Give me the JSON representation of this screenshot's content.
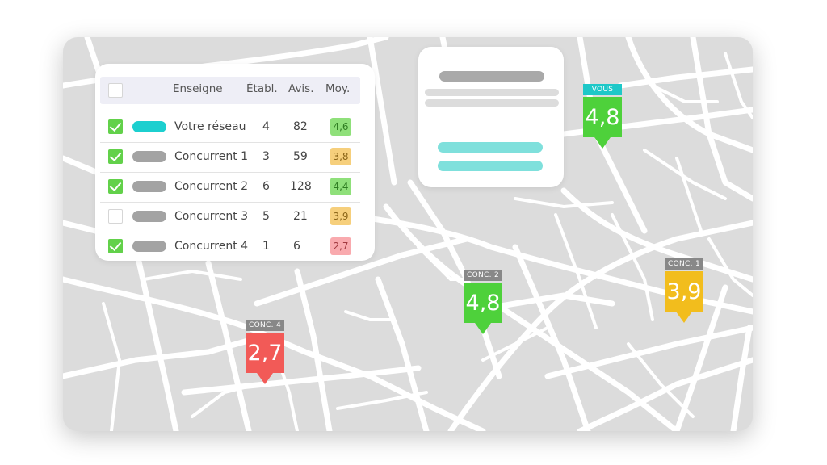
{
  "table": {
    "headers": {
      "brand": "Enseigne",
      "establishments": "Établ.",
      "reviews": "Avis.",
      "average": "Moy."
    },
    "rows": [
      {
        "checked": true,
        "pill_color": "#1ccfcf",
        "name": "Votre réseau",
        "establishments": "4",
        "reviews": "82",
        "average": "4,6",
        "badge_bg": "#8fe07a",
        "badge_fg": "#2f7d22"
      },
      {
        "checked": true,
        "pill_color": "#a3a3a3",
        "name": "Concurrent 1",
        "establishments": "3",
        "reviews": "59",
        "average": "3,8",
        "badge_bg": "#f6cf7c",
        "badge_fg": "#8a6418"
      },
      {
        "checked": true,
        "pill_color": "#a3a3a3",
        "name": "Concurrent 2",
        "establishments": "6",
        "reviews": "128",
        "average": "4,4",
        "badge_bg": "#8fe07a",
        "badge_fg": "#2f7d22"
      },
      {
        "checked": false,
        "pill_color": "#a3a3a3",
        "name": "Concurrent 3",
        "establishments": "5",
        "reviews": "21",
        "average": "3,9",
        "badge_bg": "#f6cf7c",
        "badge_fg": "#8a6418"
      },
      {
        "checked": true,
        "pill_color": "#a3a3a3",
        "name": "Concurrent 4",
        "establishments": "1",
        "reviews": "6",
        "average": "2,7",
        "badge_bg": "#f9aaae",
        "badge_fg": "#a23a40"
      }
    ]
  },
  "markers": [
    {
      "id": "vous",
      "label": "VOUS",
      "value": "4,8",
      "tag_color": "#1ec8c8",
      "color": "#4ed13b"
    },
    {
      "id": "conc-1",
      "label": "CONC. 1",
      "value": "3,9",
      "tag_color": "#888888",
      "color": "#f2bd1d"
    },
    {
      "id": "conc-2",
      "label": "CONC. 2",
      "value": "4,8",
      "tag_color": "#888888",
      "color": "#4ed13b"
    },
    {
      "id": "conc-4",
      "label": "CONC. 4",
      "value": "2,7",
      "tag_color": "#888888",
      "color": "#f25a57"
    }
  ],
  "colors": {
    "map_background": "#dcdcdc",
    "map_streets": "#ffffff",
    "placeholder_gray": "#a9a9a9",
    "placeholder_light": "#dcdcdc",
    "placeholder_teal": "#7fe0dc"
  }
}
